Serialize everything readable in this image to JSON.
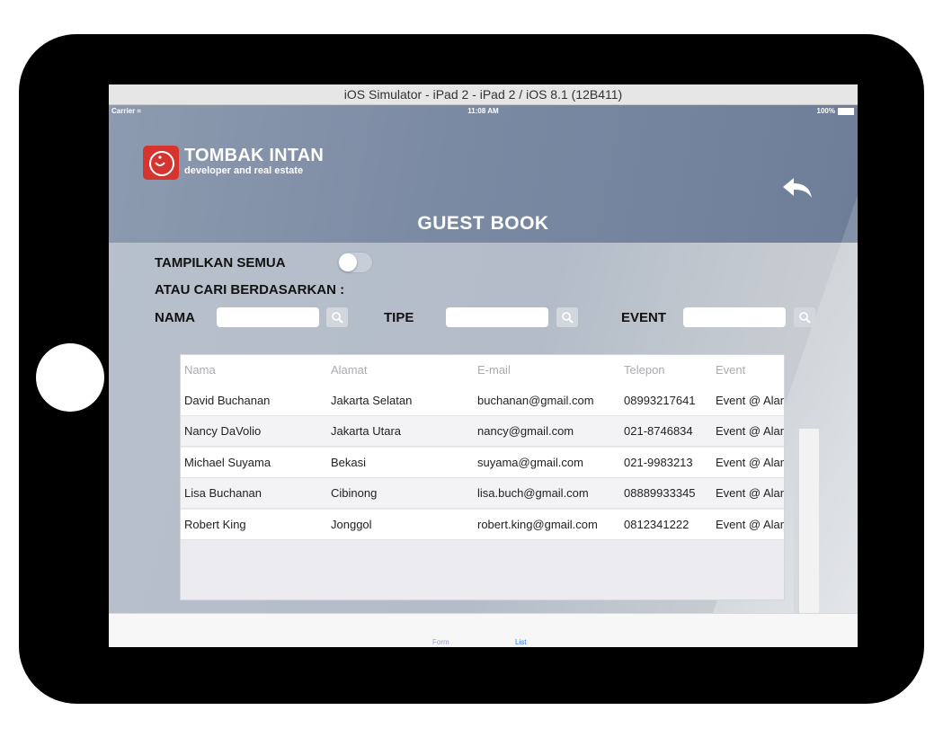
{
  "window": {
    "title": "iOS Simulator - iPad 2 - iPad 2 / iOS 8.1 (12B411)"
  },
  "statusbar": {
    "carrier": "Carrier",
    "time": "11:08 AM",
    "battery": "100%"
  },
  "brand": {
    "name": "TOMBAK INTAN",
    "tagline": "developer and real estate",
    "logo_color": "#d6342f"
  },
  "page": {
    "title": "GUEST BOOK"
  },
  "filters": {
    "show_all_label": "TAMPILKAN SEMUA",
    "show_all_on": false,
    "or_search_label": "ATAU CARI BERDASARKAN :",
    "nama_label": "NAMA",
    "tipe_label": "TIPE",
    "event_label": "EVENT",
    "nama_value": "",
    "tipe_value": "",
    "event_value": ""
  },
  "table": {
    "columns": [
      "Nama",
      "Alamat",
      "E-mail",
      "Telepon",
      "Event"
    ],
    "rows": [
      [
        "David Buchanan",
        "Jakarta Selatan",
        "buchanan@gmail.com",
        "08993217641",
        "Event @ Alam"
      ],
      [
        "Nancy DaVolio",
        "Jakarta Utara",
        "nancy@gmail.com",
        "021-8746834",
        "Event @ Alam"
      ],
      [
        "Michael Suyama",
        "Bekasi",
        "suyama@gmail.com",
        "021-9983213",
        "Event @ Alam"
      ],
      [
        "Lisa Buchanan",
        "Cibinong",
        "lisa.buch@gmail.com",
        "08889933345",
        "Event @ Alam"
      ],
      [
        "Robert King",
        "Jonggol",
        "robert.king@gmail.com",
        "0812341222",
        "Event @ Alam"
      ]
    ]
  },
  "tabbar": {
    "tabs": [
      {
        "label": "Form",
        "active": false
      },
      {
        "label": "List",
        "active": true
      }
    ],
    "active_color": "#2f7cf6",
    "inactive_color": "#9aa5c4"
  }
}
